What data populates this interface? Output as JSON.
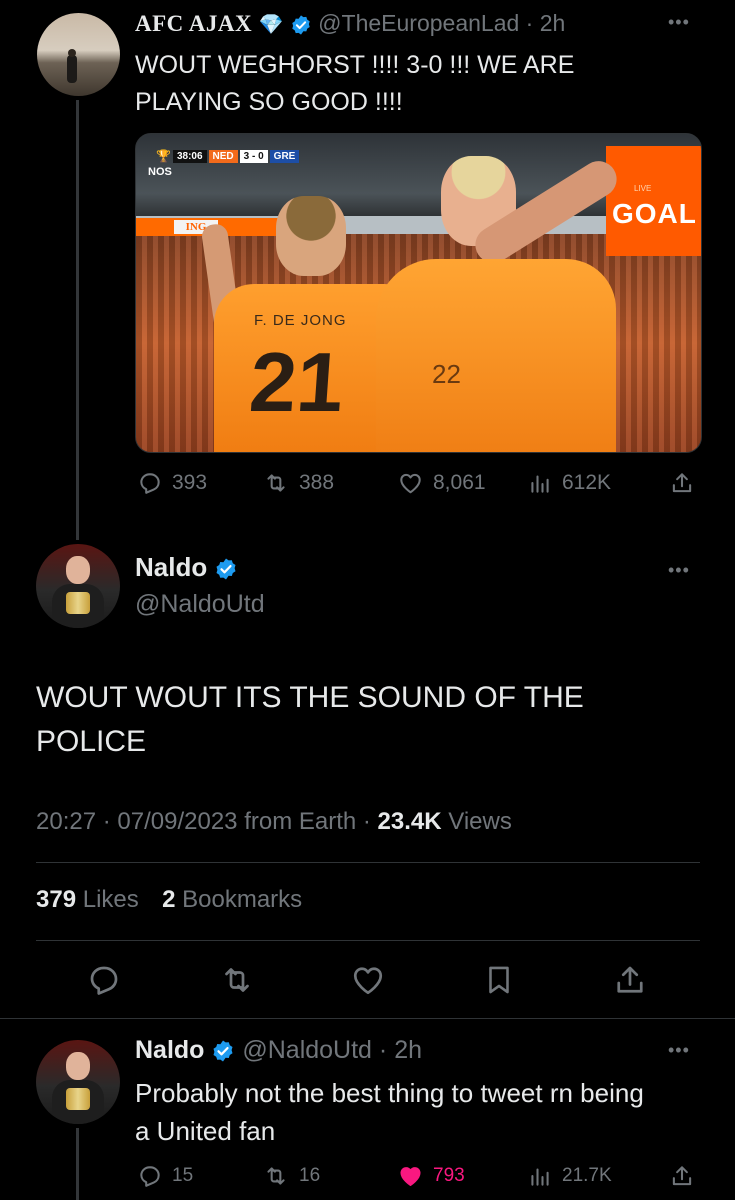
{
  "colors": {
    "background": "#000000",
    "text": "#e7e9ea",
    "muted": "#71767b",
    "verified": "#1d9bf0",
    "like_active": "#f91880"
  },
  "tweet1": {
    "display_name": "AFC AJAX",
    "name_emoji": "💎",
    "handle": "@TheEuropeanLad",
    "time": "2h",
    "text_line1": "WOUT WEGHORST !!!! 3-0 !!! WE ARE",
    "text_line2": "PLAYING SO GOOD !!!!",
    "media": {
      "clock": "38:06",
      "team_home": "NED",
      "score": "3 - 0",
      "team_away": "GRE",
      "broadcaster": "NOS",
      "board_text": "GOAL",
      "board_sub": "LIVE",
      "ad_text": "ING",
      "player1_name": "F. DE JONG",
      "player1_number": "21",
      "player2_number": "22"
    },
    "replies": "393",
    "retweets": "388",
    "likes": "8,061",
    "views": "612K"
  },
  "tweet2": {
    "display_name": "Naldo",
    "handle": "@NaldoUtd",
    "text_line1": "WOUT WOUT ITS THE SOUND OF THE",
    "text_line2": "POLICE",
    "time": "20:27",
    "date": "07/09/2023",
    "source": "from Earth",
    "views_count": "23.4K",
    "views_label": "Views",
    "likes_count": "379",
    "likes_label": "Likes",
    "bookmarks_count": "2",
    "bookmarks_label": "Bookmarks"
  },
  "tweet3": {
    "display_name": "Naldo",
    "handle": "@NaldoUtd",
    "time": "2h",
    "text_line1": "Probably not the best thing to tweet rn being",
    "text_line2": "a United fan",
    "replies": "15",
    "retweets": "16",
    "likes": "793",
    "views": "21.7K"
  },
  "icons": {
    "verified": "verified-badge-icon",
    "reply": "reply-icon",
    "retweet": "retweet-icon",
    "like": "heart-icon",
    "views": "views-chart-icon",
    "share": "share-icon",
    "bookmark": "bookmark-icon",
    "more": "more-dots-icon"
  }
}
